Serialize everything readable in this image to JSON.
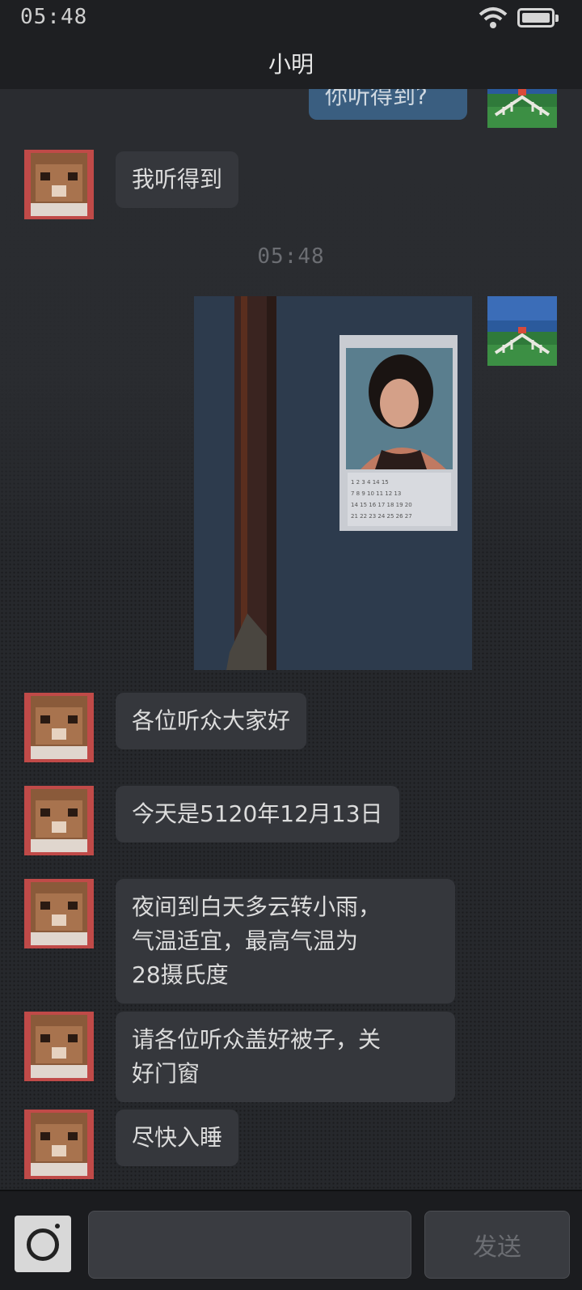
{
  "status_bar": {
    "time": "05:48",
    "wifi_icon": "wifi-icon",
    "battery_icon": "battery-icon"
  },
  "header": {
    "title": "小明"
  },
  "messages": [
    {
      "from": "me",
      "type": "text",
      "text": "你听得到?"
    },
    {
      "from": "contact",
      "type": "text",
      "text": "我听得到"
    },
    {
      "from": "system",
      "type": "timestamp",
      "text": "05:48"
    },
    {
      "from": "me",
      "type": "image",
      "description_icon": "photo-calendar-image"
    },
    {
      "from": "contact",
      "type": "text",
      "text": "各位听众大家好"
    },
    {
      "from": "contact",
      "type": "text",
      "text": "今天是5120年12月13日"
    },
    {
      "from": "contact",
      "type": "text",
      "text": "夜间到白天多云转小雨，\n气温适宜，最高气温为\n28摄氏度"
    },
    {
      "from": "contact",
      "type": "text",
      "text": "请各位听众盖好被子，关\n好门窗"
    },
    {
      "from": "contact",
      "type": "text",
      "text": "尽快入睡"
    }
  ],
  "input_bar": {
    "camera_icon": "camera-icon",
    "input_value": "",
    "send_label": "发送"
  },
  "colors": {
    "out_bubble": "#3a5e80",
    "in_bubble": "#35373c",
    "background": "#25272b"
  }
}
